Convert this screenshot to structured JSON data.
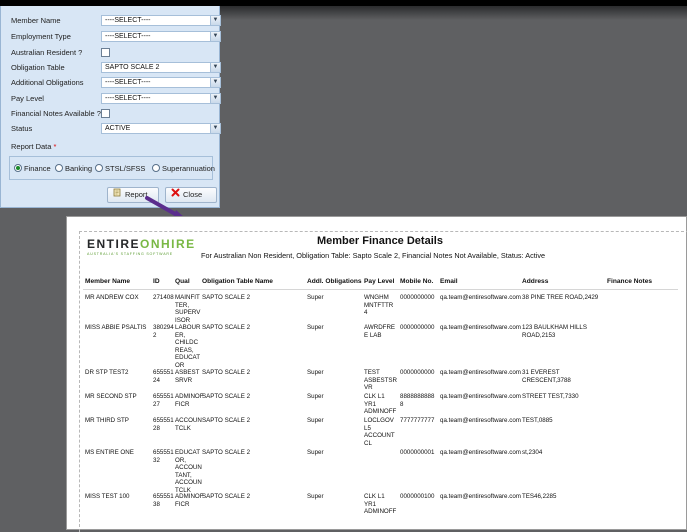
{
  "filters": {
    "rows": [
      {
        "label": "Member Name",
        "value": "----SELECT----",
        "type": "select"
      },
      {
        "label": "Employment Type",
        "value": "----SELECT----",
        "type": "select"
      },
      {
        "label": "Australian Resident ?",
        "type": "checkbox"
      },
      {
        "label": "Obligation Table",
        "value": "SAPTO SCALE 2",
        "type": "select"
      },
      {
        "label": "Additional Obligations",
        "value": "----SELECT----",
        "type": "select"
      },
      {
        "label": "Pay Level",
        "value": "----SELECT----",
        "type": "select"
      },
      {
        "label": "Financial Notes Available ?",
        "type": "checkbox"
      },
      {
        "label": "Status",
        "value": "ACTIVE",
        "type": "select"
      }
    ],
    "report_data_label": "Report Data",
    "required_marker": "*",
    "radios": [
      {
        "label": "Finance",
        "selected": true
      },
      {
        "label": "Banking",
        "selected": false
      },
      {
        "label": "STSL/SFSS",
        "selected": false
      },
      {
        "label": "Superannuation",
        "selected": false
      }
    ],
    "report_button": "Report",
    "close_button": "Close"
  },
  "report": {
    "logo_dark": "ENTIRE",
    "logo_accent": "ONHIRE",
    "logo_tagline": "AUSTRALIA'S STAFFING SOFTWARE",
    "title": "Member Finance Details",
    "subtitle": "For  Australian Non Resident, Obligation Table: Sapto Scale 2, Financial Notes Not Available, Status: Active",
    "columns": [
      "Member Name",
      "ID",
      "Qual",
      "Obligation Table Name",
      "Addl. Obligations",
      "Pay Level",
      "Mobile No.",
      "Email",
      "Address",
      "Finance Notes"
    ],
    "rows": [
      {
        "name": "MR ANDREW COX",
        "id": "271408",
        "qual": "MAINFIT\nTER,\nSUPERV\nISOR",
        "table": "SAPTO SCALE 2",
        "addl": "Super",
        "pay": "WNGHM\nMNTFTTR\n4",
        "mobile": "0000000000",
        "email": "qa.team@entiresoftware.com",
        "address": "38 PINE TREE ROAD,2429",
        "notes": ""
      },
      {
        "name": "MISS ABBIE PSALTIS",
        "id": "380294\n2",
        "qual": "LABOUR\nER,\nCHILDC\nREAS,\nEDUCAT\nOR",
        "table": "SAPTO SCALE 2",
        "addl": "Super",
        "pay": "AWRDFRE\nE LAB",
        "mobile": "0000000000",
        "email": "qa.team@entiresoftware.com",
        "address": "123 BAULKHAM HILLS\nROAD,2153",
        "notes": ""
      },
      {
        "name": "DR STP TEST2",
        "id": "655551\n24",
        "qual": "ASBEST\nSRVR",
        "table": "SAPTO SCALE 2",
        "addl": "Super",
        "pay": "TEST\nASBESTSR\nVR",
        "mobile": "0000000000",
        "email": "qa.team@entiresoftware.com",
        "address": "31 EVEREST\nCRESCENT,3788",
        "notes": ""
      },
      {
        "name": "MR SECOND STP",
        "id": "655551\n27",
        "qual": "ADMINOF\nFICR",
        "table": "SAPTO SCALE 2",
        "addl": "Super",
        "pay": "CLK L1\nYR1\nADMINOFF",
        "mobile": "8888888888\n8",
        "email": "qa.team@entiresoftware.com",
        "address": "STREET TEST,7330",
        "notes": ""
      },
      {
        "name": "MR THIRD STP",
        "id": "655551\n28",
        "qual": "ACCOUN\nTCLK",
        "table": "SAPTO SCALE 2",
        "addl": "Super",
        "pay": "LOCLGOV\nL5\nACCOUNT\nCL",
        "mobile": "7777777777",
        "email": "qa.team@entiresoftware.com",
        "address": "TEST,0885",
        "notes": ""
      },
      {
        "name": "MS ENTIRE ONE",
        "id": "655551\n32",
        "qual": "EDUCAT\nOR,\nACCOUN\nTANT,\nACCOUN\nTCLK",
        "table": "SAPTO SCALE 2",
        "addl": "Super",
        "pay": "",
        "mobile": "0000000001",
        "email": "qa.team@entiresoftware.com",
        "address": "st,2304",
        "notes": ""
      },
      {
        "name": "MISS TEST 100",
        "id": "655551\n38",
        "qual": "ADMINOF\nFICR",
        "table": "SAPTO SCALE 2",
        "addl": "Super",
        "pay": "CLK L1\nYR1\nADMINOFF",
        "mobile": "0000000100",
        "email": "qa.team@entiresoftware.com",
        "address": "TES46,2285",
        "notes": ""
      }
    ]
  }
}
